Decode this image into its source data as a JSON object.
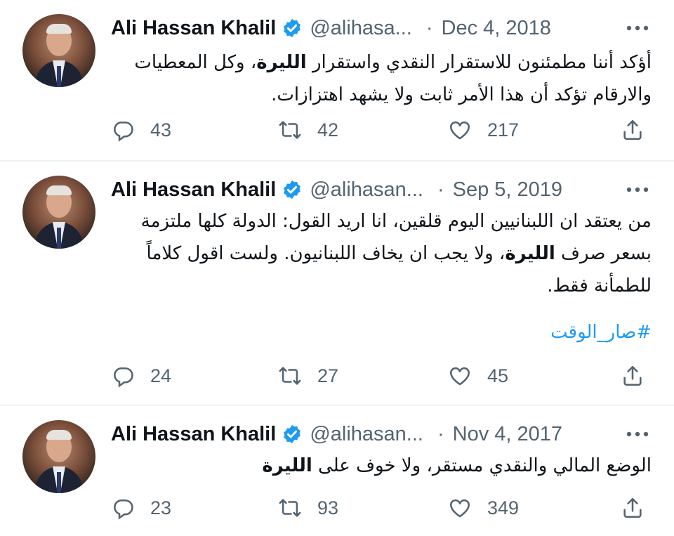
{
  "tweets": [
    {
      "author_name": "Ali Hassan Khalil",
      "handle": "@alihasa...",
      "date": "Dec 4, 2018",
      "text_lines": [
        [
          "أؤكد أننا مطمئنون للاستقرار النقدي واستقرار ",
          "الليرة",
          "، وكل المعطيات"
        ],
        [
          "والارقام تؤكد أن هذا الأمر ثابت ولا يشهد اهتزازات.",
          "",
          ""
        ]
      ],
      "hashtag": "",
      "replies": "43",
      "retweets": "42",
      "likes": "217"
    },
    {
      "author_name": "Ali Hassan Khalil",
      "handle": "@alihasan...",
      "date": "Sep 5, 2019",
      "text_lines": [
        [
          "من يعتقد ان اللبنانيين اليوم قلقين، انا اريد القول: الدولة كلها ملتزمة",
          "",
          ""
        ],
        [
          "بسعر صرف ",
          "الليرة",
          "، ولا يجب ان يخاف اللبنانيون. ولست اقول كلاماً"
        ],
        [
          "للطمأنة فقط.",
          "",
          ""
        ]
      ],
      "hashtag": "#صار_الوقت",
      "replies": "24",
      "retweets": "27",
      "likes": "45"
    },
    {
      "author_name": "Ali Hassan Khalil",
      "handle": "@alihasan...",
      "date": "Nov 4, 2017",
      "text_lines": [
        [
          "الوضع المالي والنقدي مستقر، ولا خوف على ",
          "الليرة",
          ""
        ]
      ],
      "hashtag": "",
      "replies": "23",
      "retweets": "93",
      "likes": "349"
    }
  ],
  "icons": {
    "verified": "verified-badge-icon",
    "more": "more-dots-icon",
    "reply": "reply-bubble-icon",
    "retweet": "retweet-arrows-icon",
    "like": "heart-icon",
    "share": "share-upload-icon"
  },
  "colors": {
    "text": "#0f1419",
    "secondary": "#536471",
    "accent": "#1d9bf0",
    "divider": "#eff3f4"
  }
}
